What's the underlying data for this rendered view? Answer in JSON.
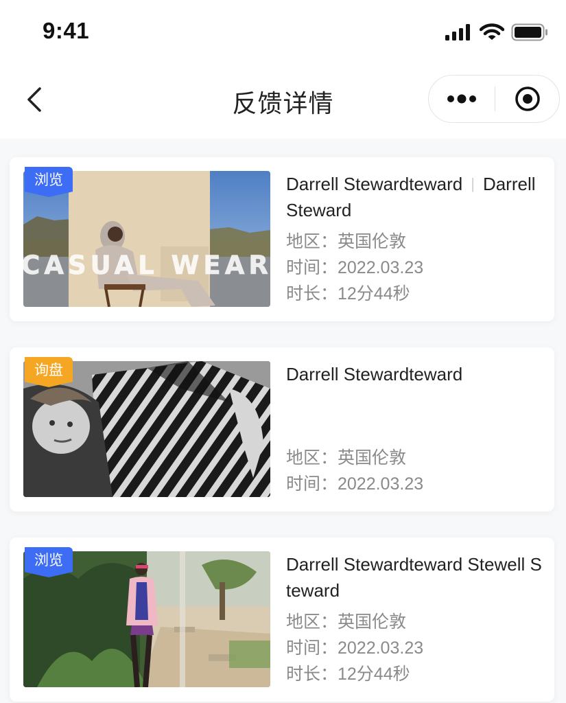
{
  "status_bar": {
    "time": "9:41"
  },
  "nav": {
    "title": "反馈详情"
  },
  "cards": [
    {
      "tag": "浏览",
      "tag_color": "#3d6df5",
      "title_main": "Darrell Stewardteward",
      "title_extra": "Darrell Steward",
      "region": "地区：英国伦敦",
      "time": "时间：2022.03.23",
      "duration": "时长：12分44秒",
      "image_text": "CASUAL WEAR"
    },
    {
      "tag": "询盘",
      "tag_color": "#f5a623",
      "title": "Darrell Stewardteward",
      "region": "地区：英国伦敦",
      "time": "时间：2022.03.23"
    },
    {
      "tag": "浏览",
      "tag_color": "#3d6df5",
      "title": "Darrell Stewardteward Stewell Steward",
      "region": "地区：英国伦敦",
      "time": "时间：2022.03.23",
      "duration": "时长：12分44秒"
    }
  ],
  "colors": {
    "accent_blue": "#3d6df5",
    "accent_orange": "#f5a623",
    "meta_gray": "#8a8a8a",
    "background": "#f7f8fa"
  },
  "icons": {
    "back": "chevron-left-icon",
    "more": "more-dots-icon",
    "close": "target-close-icon",
    "signal": "signal-icon",
    "wifi": "wifi-icon",
    "battery": "battery-icon"
  }
}
